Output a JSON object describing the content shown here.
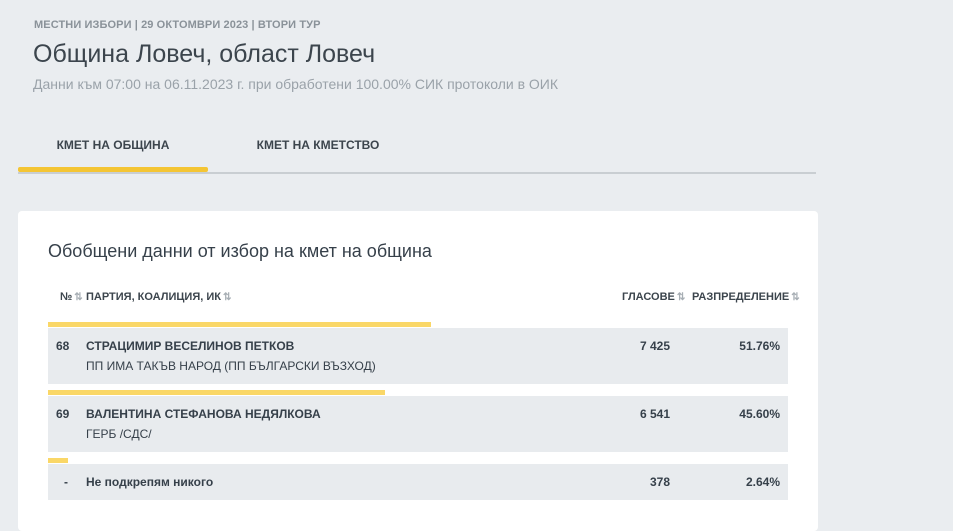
{
  "header": {
    "meta": "МЕСТНИ ИЗБОРИ | 29 ОКТОМВРИ 2023 | ВТОРИ ТУР",
    "title": "Община Ловеч, област Ловеч",
    "subtitle": "Данни към 07:00 на 06.11.2023 г. при обработени 100.00% СИК протоколи в ОИК"
  },
  "tabs": [
    {
      "label": "КМЕТ НА ОБЩИНА",
      "active": true
    },
    {
      "label": "КМЕТ НА КМЕТСТВО",
      "active": false
    }
  ],
  "card": {
    "title": "Обобщени данни от избор на кмет на община",
    "columns": {
      "number": "№",
      "party": "ПАРТИЯ, КОАЛИЦИЯ, ИК",
      "votes": "ГЛАСОВЕ",
      "share": "РАЗПРЕДЕЛЕНИЕ"
    },
    "rows": [
      {
        "number": "68",
        "name": "СТРАЦИМИР ВЕСЕЛИНОВ ПЕТКОВ",
        "party": "ПП ИМА ТАКЪВ НАРОД (ПП БЪЛГАРСКИ ВЪЗХОД)",
        "votes": "7 425",
        "share": "51.76%",
        "share_value": 51.76
      },
      {
        "number": "69",
        "name": "ВАЛЕНТИНА СТЕФАНОВА НЕДЯЛКОВА",
        "party": "ГЕРБ /СДС/",
        "votes": "6 541",
        "share": "45.60%",
        "share_value": 45.6
      },
      {
        "number": "-",
        "name": "Не подкрепям никого",
        "party": "",
        "votes": "378",
        "share": "2.64%",
        "share_value": 2.64
      }
    ]
  },
  "colors": {
    "accent": "#f4c534",
    "bar": "#fad767",
    "row_bg": "#e8ebee",
    "page_bg": "#eaedf0"
  },
  "icons": {
    "sort": "sort-arrows-icon"
  }
}
